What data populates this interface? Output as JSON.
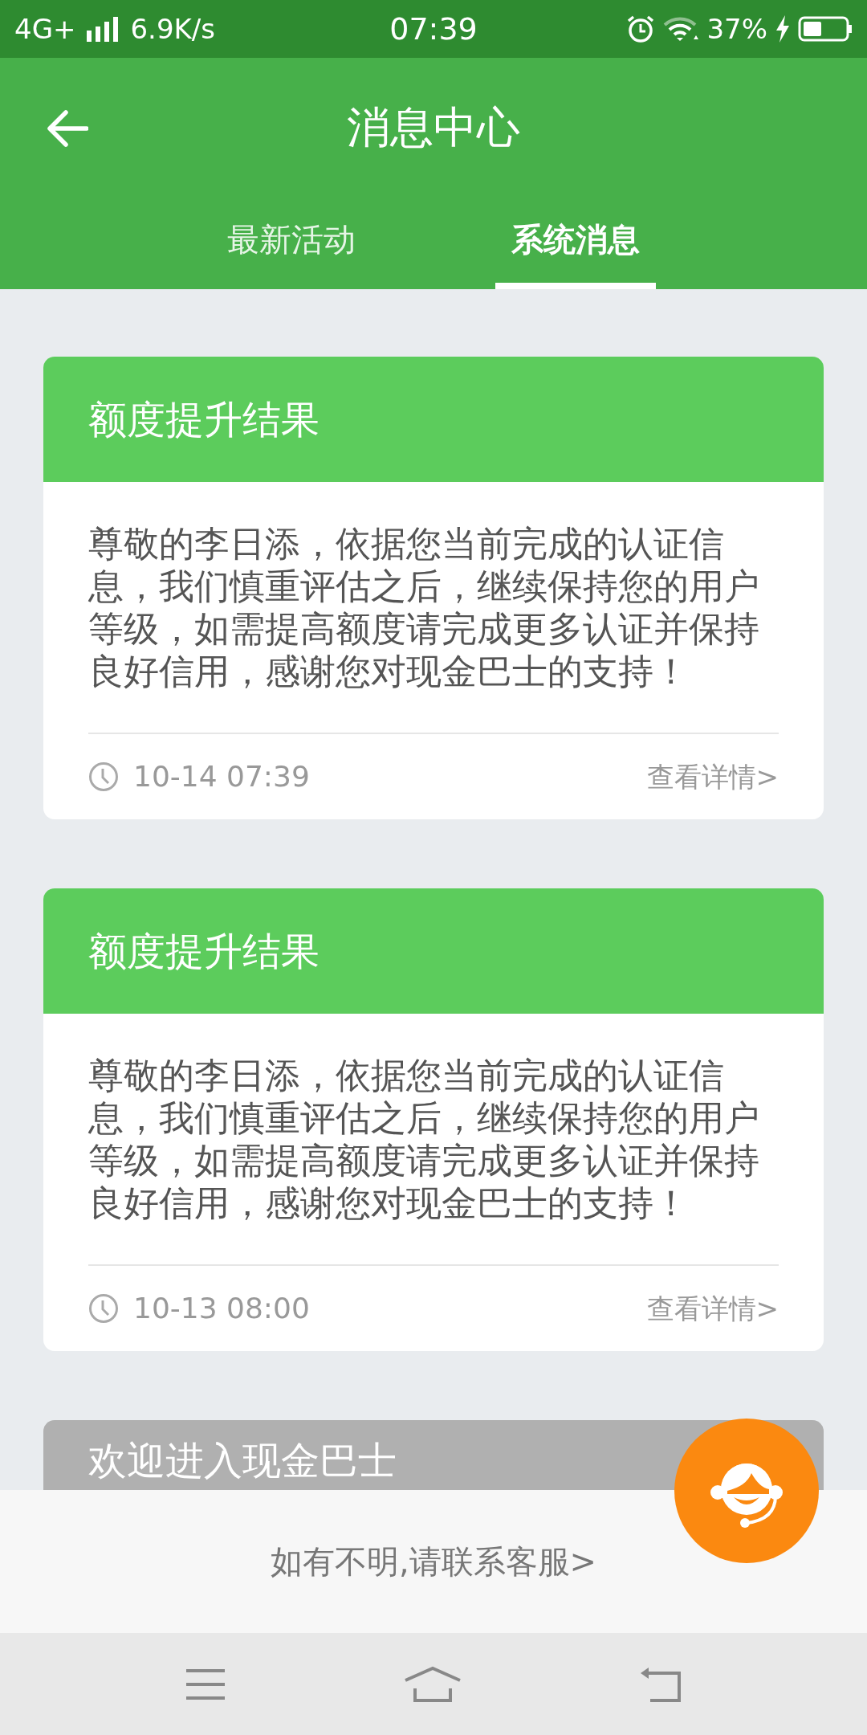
{
  "status_bar": {
    "network": "4G+",
    "speed": "6.9K/s",
    "time": "07:39",
    "battery": "37%"
  },
  "header": {
    "title": "消息中心"
  },
  "tabs": [
    {
      "label": "最新活动",
      "selected": false
    },
    {
      "label": "系统消息",
      "selected": true
    }
  ],
  "messages": [
    {
      "kind": "standard",
      "title": "额度提升结果",
      "body": "尊敬的李日添，依据您当前完成的认证信息，我们慎重评估之后，继续保持您的用户等级，如需提高额度请完成更多认证并保持良好信用，感谢您对现金巴士的支持！",
      "time": "10-14 07:39",
      "link": "查看详情>"
    },
    {
      "kind": "standard",
      "title": "额度提升结果",
      "body": "尊敬的李日添，依据您当前完成的认证信息，我们慎重评估之后，继续保持您的用户等级，如需提高额度请完成更多认证并保持良好信用，感谢您对现金巴士的支持！",
      "time": "10-13 08:00",
      "link": "查看详情>"
    },
    {
      "kind": "muted",
      "title": "欢迎进入现金巴士"
    }
  ],
  "help_bar": {
    "text": "如有不明,请联系客服>"
  }
}
